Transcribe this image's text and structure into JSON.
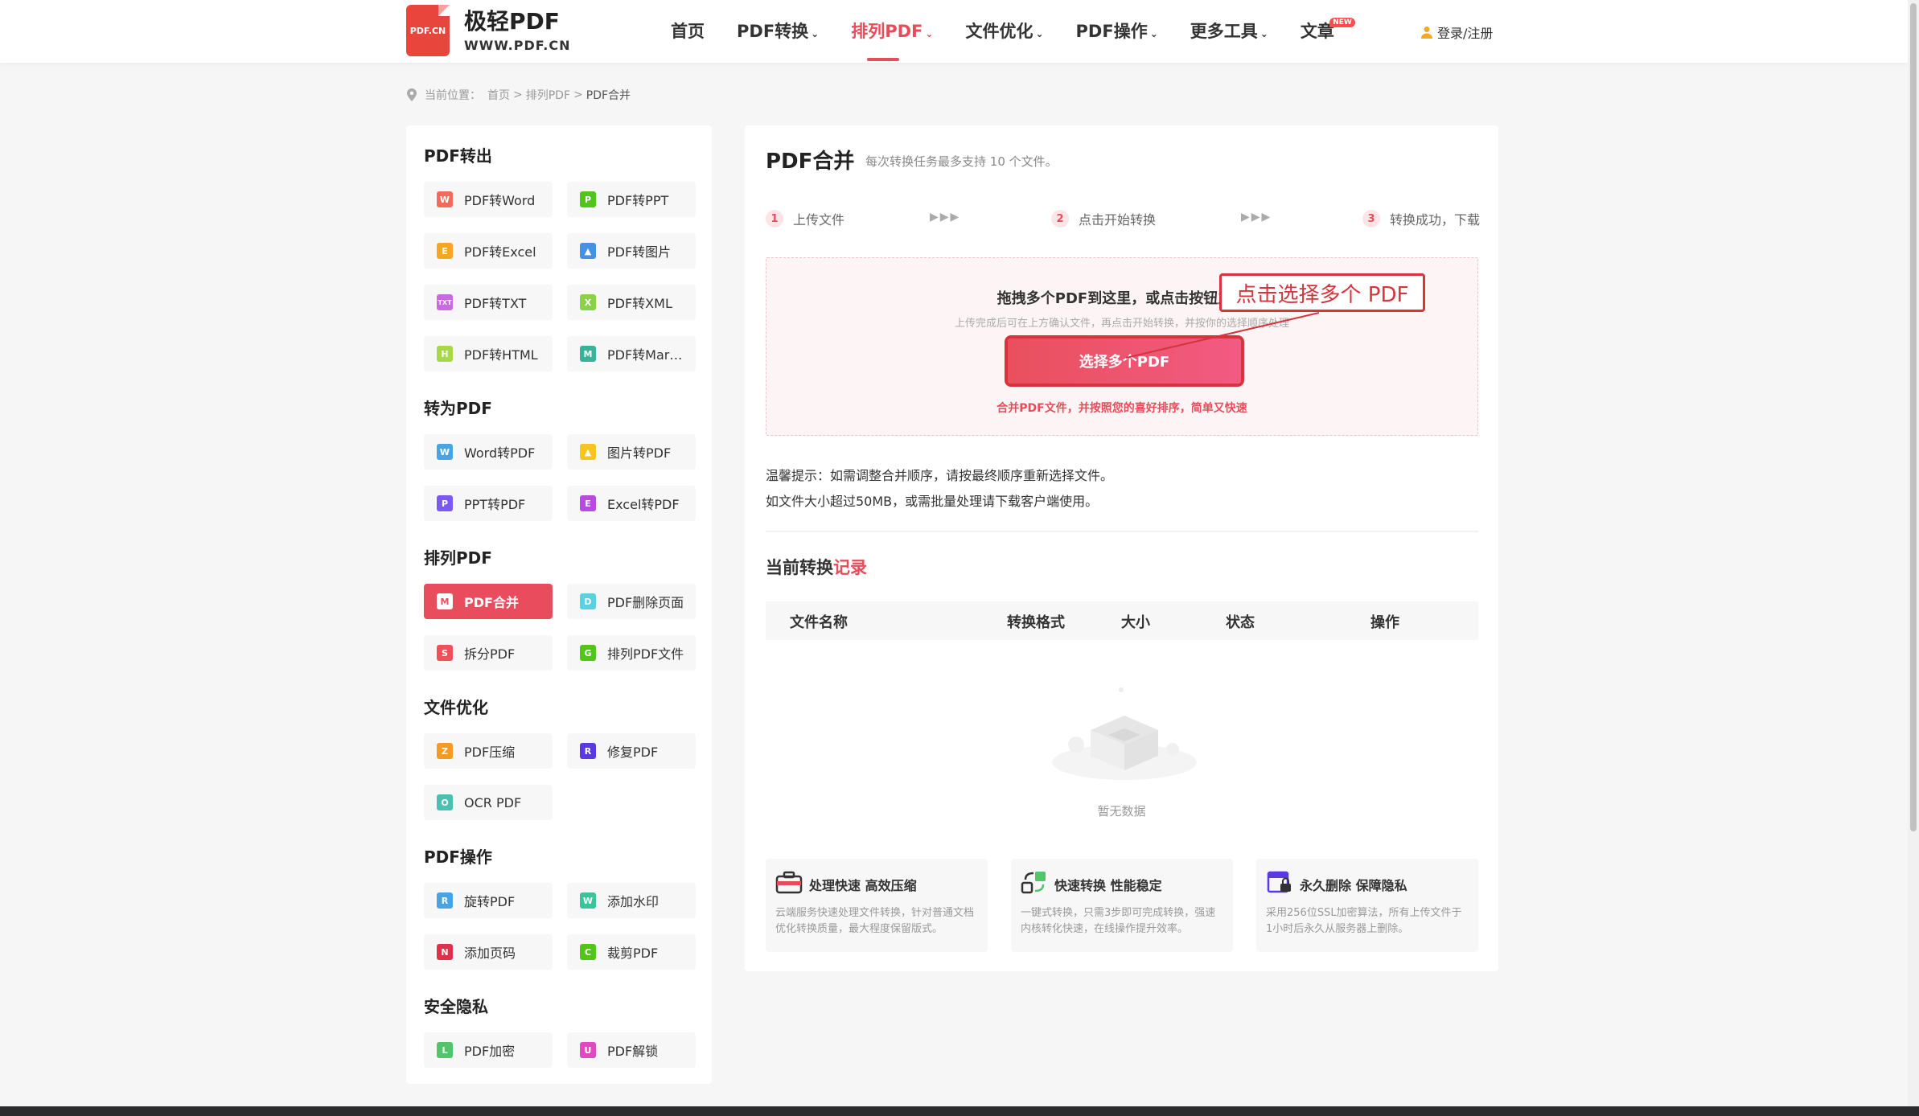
{
  "header": {
    "logo_badge": "PDF.CN",
    "logo_name": "极轻PDF",
    "logo_url": "WWW.PDF.CN",
    "nav": [
      {
        "label": "首页",
        "dropdown": false
      },
      {
        "label": "PDF转换",
        "dropdown": true
      },
      {
        "label": "排列PDF",
        "dropdown": true,
        "active": true
      },
      {
        "label": "文件优化",
        "dropdown": true
      },
      {
        "label": "PDF操作",
        "dropdown": true
      },
      {
        "label": "更多工具",
        "dropdown": true
      },
      {
        "label": "文章",
        "dropdown": false,
        "badge": "NEW"
      }
    ],
    "login": "登录/注册",
    "accent": "#e74c5b"
  },
  "breadcrumb": {
    "prefix": "当前位置：",
    "items": [
      "首页",
      "排列PDF",
      "PDF合并"
    ],
    "sep": ">"
  },
  "sidebar": {
    "sections": [
      {
        "title": "PDF转出",
        "items": [
          {
            "label": "PDF转Word",
            "icon": "W",
            "color": "#f26b5b"
          },
          {
            "label": "PDF转PPT",
            "icon": "P",
            "color": "#52c41a"
          },
          {
            "label": "PDF转Excel",
            "icon": "E",
            "color": "#f5a623"
          },
          {
            "label": "PDF转图片",
            "icon": "img",
            "color": "#4a90e2"
          },
          {
            "label": "PDF转TXT",
            "icon": "TXT",
            "color": "#c86ae0"
          },
          {
            "label": "PDF转XML",
            "icon": "X",
            "color": "#8bd14a"
          },
          {
            "label": "PDF转HTML",
            "icon": "H",
            "color": "#a6d84a"
          },
          {
            "label": "PDF转Mar…",
            "icon": "M",
            "color": "#3bb39a"
          }
        ]
      },
      {
        "title": "转为PDF",
        "items": [
          {
            "label": "Word转PDF",
            "icon": "W",
            "color": "#4aa3e2"
          },
          {
            "label": "图片转PDF",
            "icon": "img",
            "color": "#f5c623"
          },
          {
            "label": "PPT转PDF",
            "icon": "P",
            "color": "#7a5af0"
          },
          {
            "label": "Excel转PDF",
            "icon": "E",
            "color": "#b74ae0"
          }
        ]
      },
      {
        "title": "排列PDF",
        "items": [
          {
            "label": "PDF合并",
            "icon": "M",
            "color": "#e94c5c",
            "active": true
          },
          {
            "label": "PDF删除页面",
            "icon": "D",
            "color": "#5ad0e0"
          },
          {
            "label": "拆分PDF",
            "icon": "S",
            "color": "#f0505a"
          },
          {
            "label": "排列PDF文件",
            "icon": "G",
            "color": "#52c41a"
          }
        ]
      },
      {
        "title": "文件优化",
        "items": [
          {
            "label": "PDF压缩",
            "icon": "Z",
            "color": "#f59a23"
          },
          {
            "label": "修复PDF",
            "icon": "R",
            "color": "#5a3ae0"
          },
          {
            "label": "OCR PDF",
            "icon": "O",
            "color": "#4ac0b0"
          }
        ]
      },
      {
        "title": "PDF操作",
        "items": [
          {
            "label": "旋转PDF",
            "icon": "R",
            "color": "#4aa3e2"
          },
          {
            "label": "添加水印",
            "icon": "W",
            "color": "#3bc49a"
          },
          {
            "label": "添加页码",
            "icon": "N",
            "color": "#e0304a"
          },
          {
            "label": "裁剪PDF",
            "icon": "C",
            "color": "#52c41a"
          }
        ]
      },
      {
        "title": "安全隐私",
        "items": [
          {
            "label": "PDF加密",
            "icon": "L",
            "color": "#52c46a"
          },
          {
            "label": "PDF解锁",
            "icon": "U",
            "color": "#e04ac0"
          }
        ]
      }
    ]
  },
  "main": {
    "title": "PDF合并",
    "subtitle": "每次转换任务最多支持 10 个文件。",
    "steps": [
      {
        "num": "1",
        "label": "上传文件"
      },
      {
        "num": "2",
        "label": "点击开始转换"
      },
      {
        "num": "3",
        "label": "转换成功，下载"
      }
    ],
    "step_arrows": "▶▶▶",
    "drop": {
      "title": "拖拽多个PDF到这里，或点击按钮立即",
      "sub": "上传完成后可在上方确认文件，再点击开始转换，并按你的选择顺序处理",
      "button": "选择多个PDF",
      "note": "合并PDF文件，并按照您的喜好排序，简单又快速"
    },
    "callout": "点击选择多个 PDF",
    "tips": [
      "温馨提示：如需调整合并顺序，请按最终顺序重新选择文件。",
      "如文件大小超过50MB，或需批量处理请下载客户端使用。"
    ],
    "records": {
      "title_a": "当前转换",
      "title_b": "记录",
      "columns": [
        "文件名称",
        "转换格式",
        "大小",
        "状态",
        "操作"
      ],
      "empty": "暂无数据"
    },
    "features": [
      {
        "title": "处理快速 高效压缩",
        "desc": "云端服务快速处理文件转换，针对普通文档优化转换质量，最大程度保留版式。",
        "icon": "briefcase-icon"
      },
      {
        "title": "快速转换 性能稳定",
        "desc": "一键式转换，只需3步即可完成转换，强速内核转化快速，在线操作提升效率。",
        "icon": "convert-icon"
      },
      {
        "title": "永久删除 保障隐私",
        "desc": "采用256位SSL加密算法，所有上传文件于1小时后永久从服务器上删除。",
        "icon": "privacy-icon"
      }
    ]
  }
}
